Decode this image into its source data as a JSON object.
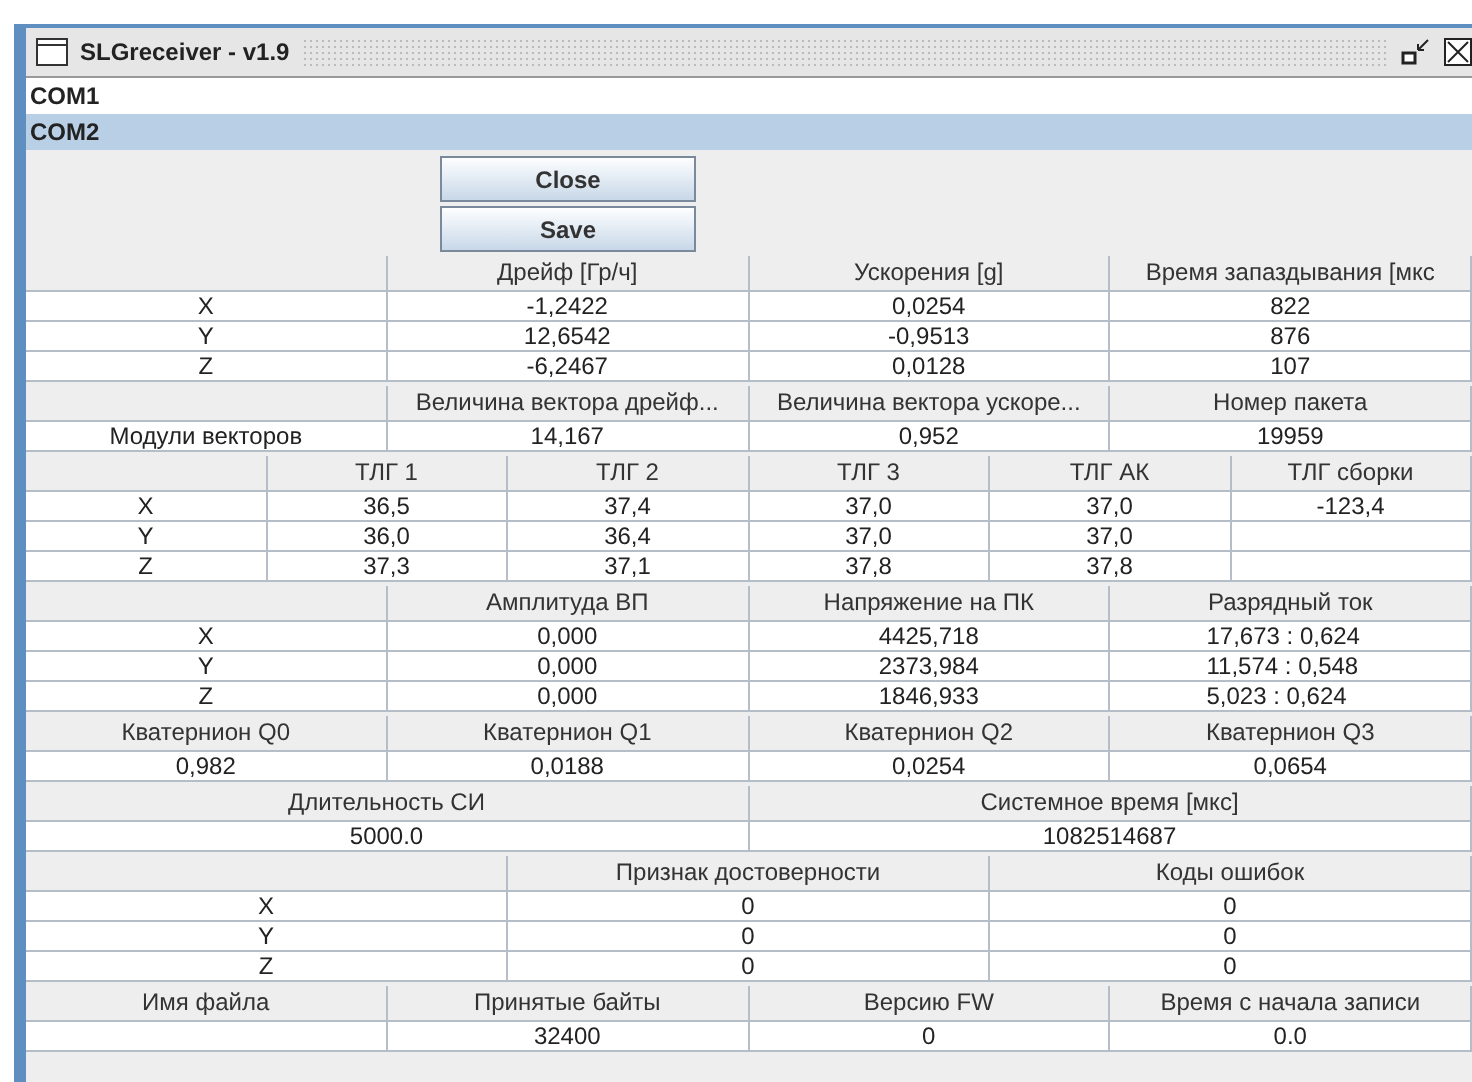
{
  "window": {
    "title": "SLGreceiver - v1.9"
  },
  "ports": [
    {
      "label": "COM1",
      "selected": false
    },
    {
      "label": "COM2",
      "selected": true
    }
  ],
  "buttons": [
    "Close",
    "Save"
  ],
  "tables": [
    {
      "headers": [
        "Дрейф [Гр/ч]",
        "Ускорения [g]",
        "Время запаздывания [мкс"
      ],
      "rows": [
        [
          "X",
          "-1,2422",
          "0,0254",
          "822"
        ],
        [
          "Y",
          "12,6542",
          "-0,9513",
          "876"
        ],
        [
          "Z",
          "-6,2467",
          "0,0128",
          "107"
        ]
      ]
    },
    {
      "headers": [
        "Величина вектора дрейф...",
        "Величина вектора ускоре...",
        "Номер пакета"
      ],
      "rows": [
        [
          "Модули векторов",
          "14,167",
          "0,952",
          "19959"
        ]
      ]
    },
    {
      "headers": [
        "ТЛГ 1",
        "ТЛГ 2",
        "ТЛГ 3",
        "ТЛГ  АК",
        "ТЛГ сборки"
      ],
      "rows": [
        [
          "X",
          "36,5",
          "37,4",
          "37,0",
          "37,0",
          "-123,4"
        ],
        [
          "Y",
          "36,0",
          "36,4",
          "37,0",
          "37,0"
        ],
        [
          "Z",
          "37,3",
          "37,1",
          "37,8",
          "37,8"
        ]
      ]
    },
    {
      "headers": [
        "Амплитуда ВП",
        "Напряжение на ПК",
        "Разрядный ток"
      ],
      "rows": [
        [
          "X",
          "0,000",
          "4425,718",
          "17,673 : 0,624"
        ],
        [
          "Y",
          "0,000",
          "2373,984",
          "11,574 : 0,548"
        ],
        [
          "Z",
          "0,000",
          "1846,933",
          "5,023 : 0,624"
        ]
      ]
    },
    {
      "headers": [
        "Кватернион  Q0",
        "Кватернион  Q1",
        "Кватернион  Q2",
        "Кватернион  Q3"
      ],
      "rows": [
        [
          "0,982",
          "0,0188",
          "0,0254",
          "0,0654"
        ]
      ]
    },
    {
      "headers": [
        "Длительность СИ",
        "Системное время [мкс]"
      ],
      "rows": [
        [
          "5000.0",
          "1082514687"
        ]
      ]
    },
    {
      "headers": [
        "Признак достоверности",
        "Коды ошибок"
      ],
      "rows": [
        [
          "X",
          "0",
          "0"
        ],
        [
          "Y",
          "0",
          "0"
        ],
        [
          "Z",
          "0",
          "0"
        ]
      ]
    },
    {
      "headers": [
        "Имя файла",
        "Принятые байты",
        "Версию FW",
        "Время с начала записи"
      ],
      "rows": [
        [
          {},
          "32400",
          "0",
          "0.0"
        ]
      ]
    }
  ]
}
